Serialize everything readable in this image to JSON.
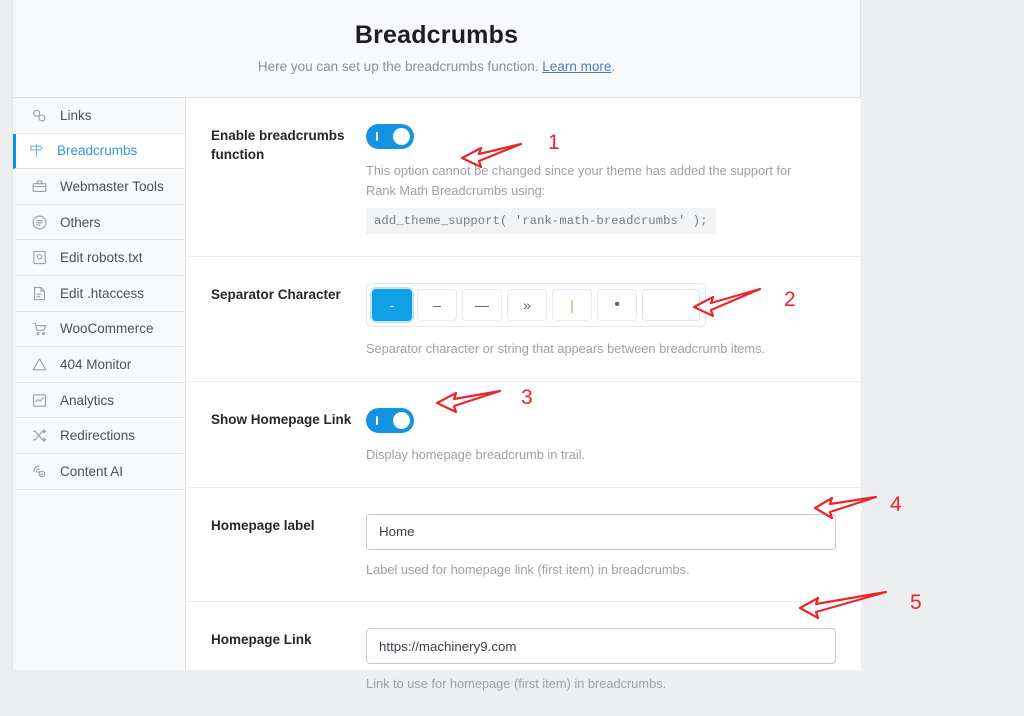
{
  "header": {
    "title": "Breadcrumbs",
    "subtitle_before": "Here you can set up the breadcrumbs function. ",
    "learn_more": "Learn more",
    "subtitle_after": "."
  },
  "sidebar": {
    "items": [
      {
        "label": "Links",
        "icon": "link-icon",
        "active": false
      },
      {
        "label": "Breadcrumbs",
        "icon": "signpost-icon",
        "active": true
      },
      {
        "label": "Webmaster Tools",
        "icon": "toolbox-icon",
        "active": false
      },
      {
        "label": "Others",
        "icon": "list-circle-icon",
        "active": false
      },
      {
        "label": "Edit robots.txt",
        "icon": "robots-file-icon",
        "active": false
      },
      {
        "label": "Edit .htaccess",
        "icon": "document-icon",
        "active": false
      },
      {
        "label": "WooCommerce",
        "icon": "cart-icon",
        "active": false
      },
      {
        "label": "404 Monitor",
        "icon": "warning-icon",
        "active": false
      },
      {
        "label": "Analytics",
        "icon": "chart-icon",
        "active": false
      },
      {
        "label": "Redirections",
        "icon": "shuffle-icon",
        "active": false
      },
      {
        "label": "Content AI",
        "icon": "content-ai-icon",
        "active": false
      }
    ]
  },
  "fields": {
    "enable_breadcrumbs": {
      "label": "Enable breadcrumbs function",
      "toggle_on": true,
      "help_line1": "This option cannot be changed since your theme has added the support for Rank Math Breadcrumbs using:",
      "code": "add_theme_support( 'rank-math-breadcrumbs' );"
    },
    "separator": {
      "label": "Separator Character",
      "options": [
        "-",
        "–",
        "—",
        "»",
        "|",
        "•"
      ],
      "selected_index": 0,
      "custom_value": "",
      "custom_placeholder": "",
      "help": "Separator character or string that appears between breadcrumb items."
    },
    "show_homepage_link": {
      "label": "Show Homepage Link",
      "toggle_on": true,
      "help": "Display homepage breadcrumb in trail."
    },
    "homepage_label": {
      "label": "Homepage label",
      "value": "Home",
      "placeholder": "Home",
      "help": "Label used for homepage link (first item) in breadcrumbs."
    },
    "homepage_link": {
      "label": "Homepage Link",
      "value": "https://machinery9.com",
      "placeholder": "https://machinery9.com",
      "help": "Link to use for homepage (first item) in breadcrumbs."
    }
  },
  "annotations": {
    "color": "#e8262b",
    "markers": [
      {
        "number": "1"
      },
      {
        "number": "2"
      },
      {
        "number": "3"
      },
      {
        "number": "4"
      },
      {
        "number": "5"
      }
    ]
  },
  "colors": {
    "accent_blue": "#10a0e5",
    "toggle_blue": "#1494e0",
    "annotation_red": "#e8262b",
    "page_background": "#eceef0",
    "panel_background": "#ffffff"
  }
}
